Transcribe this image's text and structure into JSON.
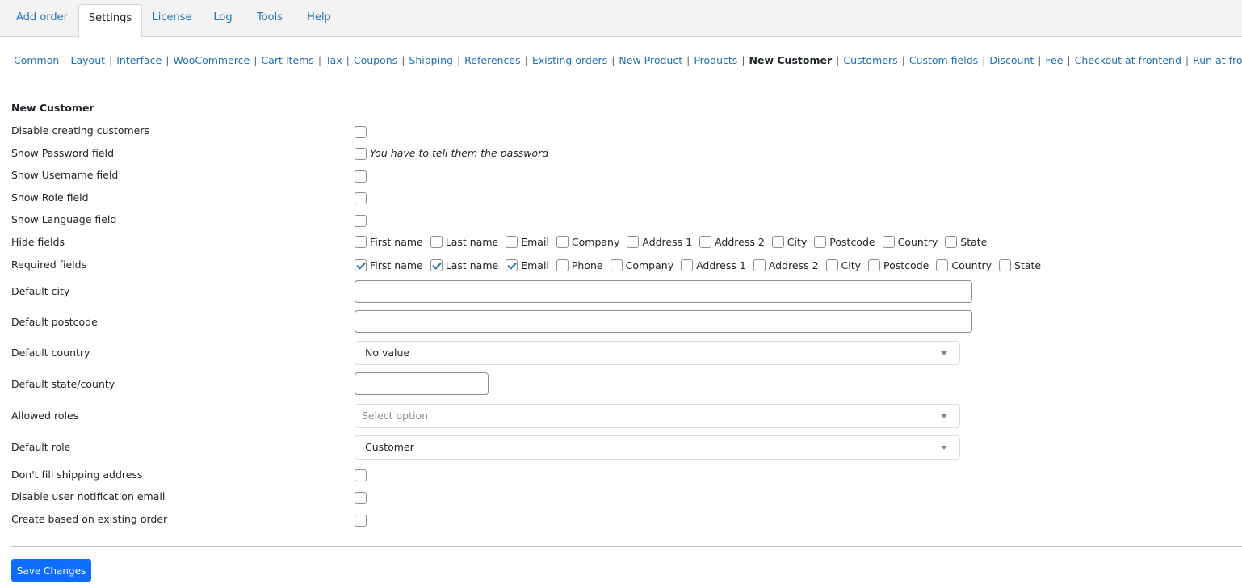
{
  "tabs": [
    "Add order",
    "Settings",
    "License",
    "Log",
    "Tools",
    "Help"
  ],
  "active_tab": "Settings",
  "subnav": [
    "Common",
    "Layout",
    "Interface",
    "WooCommerce",
    "Cart Items",
    "Tax",
    "Coupons",
    "Shipping",
    "References",
    "Existing orders",
    "New Product",
    "Products",
    "New Customer",
    "Customers",
    "Custom fields",
    "Discount",
    "Fee",
    "Checkout at frontend",
    "Run at frontend"
  ],
  "subnav_current": "New Customer",
  "section_title": "New Customer",
  "labels": {
    "disable_creating": "Disable creating customers",
    "show_password": "Show Password field",
    "password_note": "You have to tell them the password",
    "show_username": "Show Username field",
    "show_role": "Show Role field",
    "show_language": "Show Language field",
    "hide_fields": "Hide fields",
    "required_fields": "Required fields",
    "default_city": "Default city",
    "default_postcode": "Default postcode",
    "default_country": "Default country",
    "default_state": "Default state/county",
    "allowed_roles": "Allowed roles",
    "default_role": "Default role",
    "dont_fill_shipping": "Don't fill shipping address",
    "disable_notification": "Disable user notification email",
    "create_based_on_order": "Create based on existing order"
  },
  "hide_fields_options": [
    {
      "label": "First name",
      "checked": false
    },
    {
      "label": "Last name",
      "checked": false
    },
    {
      "label": "Email",
      "checked": false
    },
    {
      "label": "Company",
      "checked": false
    },
    {
      "label": "Address 1",
      "checked": false
    },
    {
      "label": "Address 2",
      "checked": false
    },
    {
      "label": "City",
      "checked": false
    },
    {
      "label": "Postcode",
      "checked": false
    },
    {
      "label": "Country",
      "checked": false
    },
    {
      "label": "State",
      "checked": false
    }
  ],
  "required_fields_options": [
    {
      "label": "First name",
      "checked": true
    },
    {
      "label": "Last name",
      "checked": true
    },
    {
      "label": "Email",
      "checked": true
    },
    {
      "label": "Phone",
      "checked": false
    },
    {
      "label": "Company",
      "checked": false
    },
    {
      "label": "Address 1",
      "checked": false
    },
    {
      "label": "Address 2",
      "checked": false
    },
    {
      "label": "City",
      "checked": false
    },
    {
      "label": "Postcode",
      "checked": false
    },
    {
      "label": "Country",
      "checked": false
    },
    {
      "label": "State",
      "checked": false
    }
  ],
  "values": {
    "default_city": "",
    "default_postcode": "",
    "default_country": "No value",
    "default_state": "",
    "allowed_roles_placeholder": "Select option",
    "default_role": "Customer"
  },
  "save_button": "Save Changes",
  "colors": {
    "link": "#2271b1",
    "primary_button": "#0d6efd",
    "check": "#2271b1"
  },
  "icons": {
    "dropdown": "chevron-down-icon",
    "checkbox_checked": "checkmark-icon"
  }
}
